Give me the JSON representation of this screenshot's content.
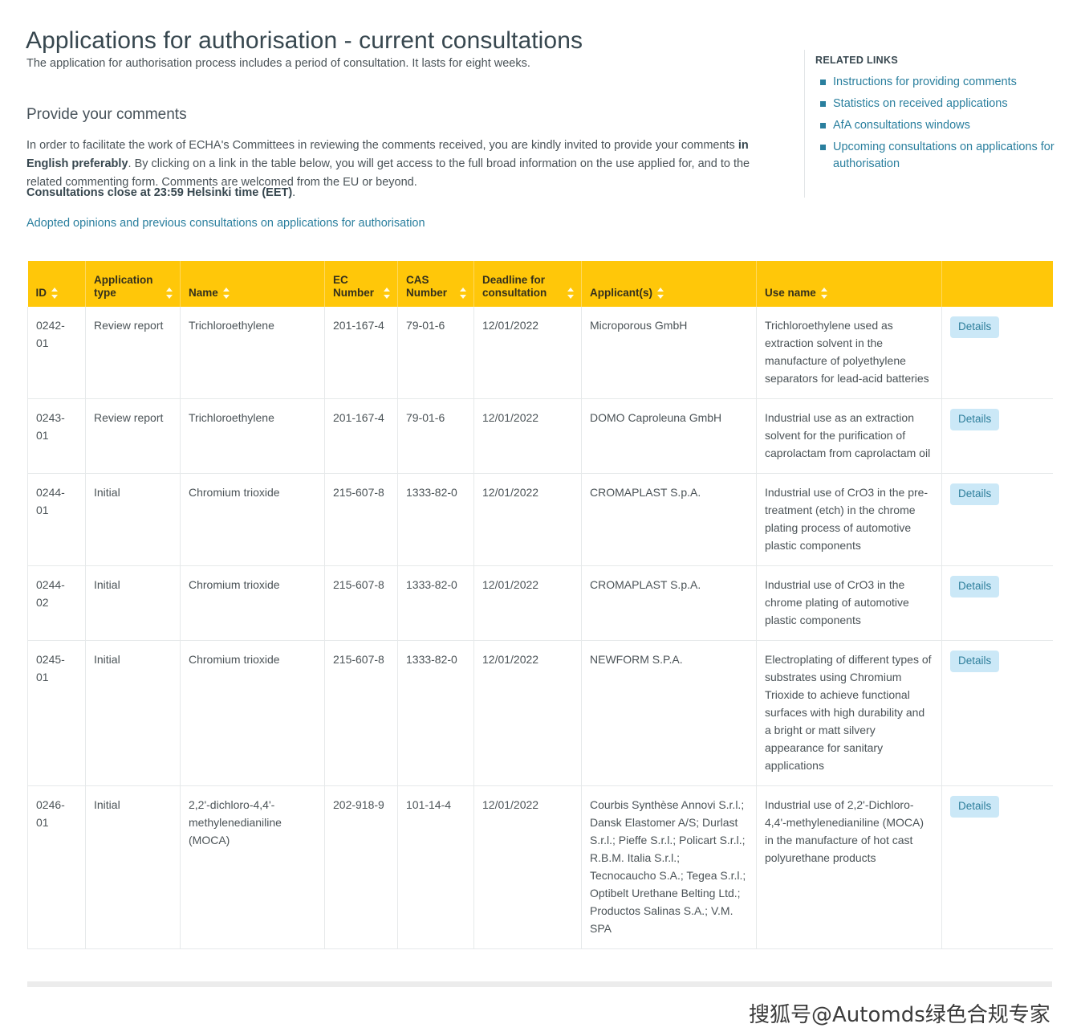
{
  "page": {
    "title": "Applications for authorisation - current consultations",
    "intro": "The application for authorisation process includes a period of consultation. It lasts for eight weeks.",
    "subheading": "Provide your comments",
    "paragraph_part1": "In order to facilitate the work of ECHA's Committees in reviewing the comments received, you are kindly invited to provide your comments ",
    "paragraph_bold": "in English preferably",
    "paragraph_part2": ". By clicking on a link in the table below, you will get access to the full broad information on the use applied for, and to the related commenting form. Comments are welcomed from the EU or beyond.",
    "close_note": "Consultations close at 23:59 Helsinki time (EET)",
    "close_note_tail": ".",
    "adopted_link": "Adopted opinions and previous consultations on applications for authorisation"
  },
  "related_links": {
    "title": "RELATED LINKS",
    "items": [
      {
        "label": "Instructions for providing comments"
      },
      {
        "label": "Statistics on received applications"
      },
      {
        "label": "AfA consultations windows"
      },
      {
        "label": "Upcoming consultations on applications for authorisation"
      }
    ]
  },
  "table": {
    "columns": [
      {
        "label": "ID",
        "sortable": true
      },
      {
        "label": "Application type",
        "sortable": true
      },
      {
        "label": "Name",
        "sortable": true
      },
      {
        "label": "EC Number",
        "sortable": true
      },
      {
        "label": "CAS Number",
        "sortable": true
      },
      {
        "label": "Deadline for consultation",
        "sortable": true
      },
      {
        "label": "Applicant(s)",
        "sortable": true
      },
      {
        "label": "Use name",
        "sortable": true
      },
      {
        "label": "",
        "sortable": false
      }
    ],
    "details_label": "Details",
    "rows": [
      {
        "id": "0242-01",
        "application_type": "Review report",
        "name": "Trichloroethylene",
        "ec_number": "201-167-4",
        "cas_number": "79-01-6",
        "deadline": "12/01/2022",
        "applicants": "Microporous GmbH",
        "use_name": "Trichloroethylene used as extraction solvent in the manufacture of polyethylene separators for lead-acid batteries"
      },
      {
        "id": "0243-01",
        "application_type": "Review report",
        "name": "Trichloroethylene",
        "ec_number": "201-167-4",
        "cas_number": "79-01-6",
        "deadline": "12/01/2022",
        "applicants": "DOMO Caproleuna GmbH",
        "use_name": "Industrial use as an extraction solvent for the purification of caprolactam from caprolactam oil"
      },
      {
        "id": "0244-01",
        "application_type": "Initial",
        "name": "Chromium trioxide",
        "ec_number": "215-607-8",
        "cas_number": "1333-82-0",
        "deadline": "12/01/2022",
        "applicants": "CROMAPLAST S.p.A.",
        "use_name": "Industrial use of CrO3 in the pre-treatment (etch) in the chrome plating process of automotive plastic components"
      },
      {
        "id": "0244-02",
        "application_type": "Initial",
        "name": "Chromium trioxide",
        "ec_number": "215-607-8",
        "cas_number": "1333-82-0",
        "deadline": "12/01/2022",
        "applicants": "CROMAPLAST S.p.A.",
        "use_name": "Industrial use of CrO3 in the chrome plating of automotive plastic components"
      },
      {
        "id": "0245-01",
        "application_type": "Initial",
        "name": "Chromium trioxide",
        "ec_number": "215-607-8",
        "cas_number": "1333-82-0",
        "deadline": "12/01/2022",
        "applicants": "NEWFORM S.P.A.",
        "use_name": "Electroplating of different types of substrates using Chromium Trioxide to achieve functional surfaces with high durability and a bright or matt silvery appearance for sanitary applications"
      },
      {
        "id": "0246-01",
        "application_type": "Initial",
        "name": "2,2'-dichloro-4,4'-methylenedianiline (MOCA)",
        "ec_number": "202-918-9",
        "cas_number": "101-14-4",
        "deadline": "12/01/2022",
        "applicants": "Courbis Synthèse Annovi S.r.l.; Dansk Elastomer A/S; Durlast S.r.l.; Pieffe S.r.l.; Policart S.r.l.; R.B.M. Italia S.r.l.; Tecnocaucho S.A.; Tegea S.r.l.; Optibelt Urethane Belting Ltd.; Productos Salinas S.A.; V.M. SPA",
        "use_name": "Industrial use of 2,2'-Dichloro-4,4'-methylenedianiline (MOCA) in the manufacture of hot cast polyurethane products"
      }
    ]
  },
  "footer": {
    "watermark": "搜狐号@Automds绿色合规专家"
  },
  "colors": {
    "header_yellow": "#ffc709",
    "link_blue": "#2a7f9e",
    "details_bg": "#cbe8f7",
    "text": "#4b5357"
  }
}
